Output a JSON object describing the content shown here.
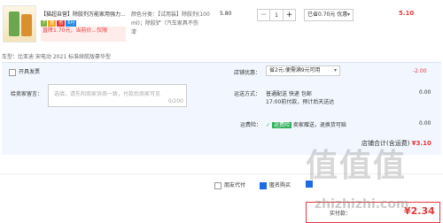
{
  "item": {
    "title": "【猫超自营】除胶剂万能家用强力...",
    "tags": [
      "7",
      "蓝",
      "省",
      "6月"
    ],
    "benefit": "直降1.70元，当前价...仅限",
    "spec_line1": "颜色分类：【试用装】除胶剂(100",
    "spec_line2": "ml)；除胶铲（汽车家具不伤",
    "spec_line3": "漆",
    "unit_price": "5.80",
    "quantity": "1",
    "promo": "已省0.70元 优惠",
    "total": "5.10"
  },
  "vehicle": "车型：比亚迪 宋电动 2021 标准续航版豪华型",
  "invoice_label": "开具发票",
  "message": {
    "label": "给卖家留言：",
    "placeholder": "选填，请先和商家协商一致，付款后商家可见",
    "counter": "0/200"
  },
  "store_discount": {
    "label": "店铺优惠：",
    "value": "省2元:便需满9元可用",
    "amount": "-2.00"
  },
  "shipping": {
    "label": "运送方式：",
    "line1": "普通配送 快递 包邮",
    "line2": "17:00前付款，预计后天送达",
    "amount": "0.00"
  },
  "return_insurance": {
    "label": "运费险：",
    "badge": "运费险",
    "text": "卖家赠送，退换货可赔",
    "amount": "0.00"
  },
  "subtotal": {
    "label": "店铺合计(含运费)",
    "value": "¥3.10"
  },
  "footer": {
    "friend_pay": "朋友代付",
    "anonymous": "匿名购买"
  },
  "pay": {
    "label": "实付款：",
    "currency": "¥",
    "amount": "2.34"
  },
  "watermark": {
    "logo": "值值值",
    "url": "zhizhizhi.com"
  },
  "colors": {
    "accent": "#e4393c",
    "panel": "#f2f7ff",
    "link": "#1d6be6"
  }
}
